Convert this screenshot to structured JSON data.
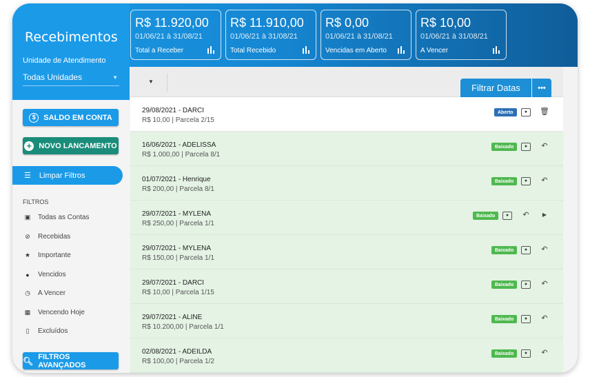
{
  "app": {
    "title": "Recebimentos"
  },
  "unit": {
    "label": "Unidade de Atendimento",
    "value": "Todas Unidades"
  },
  "cards": [
    {
      "amount": "R$ 11.920,00",
      "range": "01/06/21 à 31/08/21",
      "label": "Total a Receber"
    },
    {
      "amount": "R$ 11.910,00",
      "range": "01/06/21 à 31/08/21",
      "label": "Total Recebido"
    },
    {
      "amount": "R$ 0,00",
      "range": "01/06/21 à 31/08/21",
      "label": "Vencidas em Aberto"
    },
    {
      "amount": "R$ 10,00",
      "range": "01/06/21 à 31/08/21",
      "label": "A Vencer"
    }
  ],
  "sidebar": {
    "balance_button": "SALDO EM CONTA",
    "new_button": "NOVO LANCAMENTO",
    "clear_filters": "Limpar Filtros",
    "filters_title": "FILTROS",
    "filters": [
      {
        "label": "Todas as Contas",
        "icon": "all-accounts-icon"
      },
      {
        "label": "Recebidas",
        "icon": "check-circle-icon"
      },
      {
        "label": "Importante",
        "icon": "star-icon"
      },
      {
        "label": "Vencidos",
        "icon": "alert-icon"
      },
      {
        "label": "A Vencer",
        "icon": "clock-icon"
      },
      {
        "label": "Vencendo Hoje",
        "icon": "calendar-icon"
      },
      {
        "label": "Excluídos",
        "icon": "trash-icon"
      }
    ],
    "advanced_button": "FILTROS AVANÇADOS"
  },
  "toolbar": {
    "filter_dates": "Filtrar Datas",
    "more": "•••"
  },
  "rows": [
    {
      "title": "29/08/2021 - DARCI",
      "sub": "R$ 10,00 | Parcela 2/15",
      "status": "Aberto"
    },
    {
      "title": "16/06/2021 - ADELISSA",
      "sub": "R$ 1.000,00 | Parcela 8/1",
      "status": "Baixado"
    },
    {
      "title": "01/07/2021 - Henrique",
      "sub": "R$ 200,00 | Parcela 8/1",
      "status": "Baixado"
    },
    {
      "title": "29/07/2021 - MYLENA",
      "sub": "R$ 250,00 | Parcela 1/1",
      "status": "Baixado"
    },
    {
      "title": "29/07/2021 - MYLENA",
      "sub": "R$ 150,00 | Parcela 1/1",
      "status": "Baixado"
    },
    {
      "title": "29/07/2021 - DARCI",
      "sub": "R$ 10,00 | Parcela 1/15",
      "status": "Baixado"
    },
    {
      "title": "29/07/2021 - ALINE",
      "sub": "R$ 10.200,00 | Parcela 1/1",
      "status": "Baixado"
    },
    {
      "title": "02/08/2021 - ADEILDA",
      "sub": "R$ 100,00 | Parcela 1/2",
      "status": "Baixado"
    }
  ],
  "colors": {
    "primary": "#1b9ae8",
    "green": "#1a8c7a",
    "paid_badge": "#4fb84f",
    "open_badge": "#2d6fb5",
    "paid_row": "#e4f3e4"
  }
}
